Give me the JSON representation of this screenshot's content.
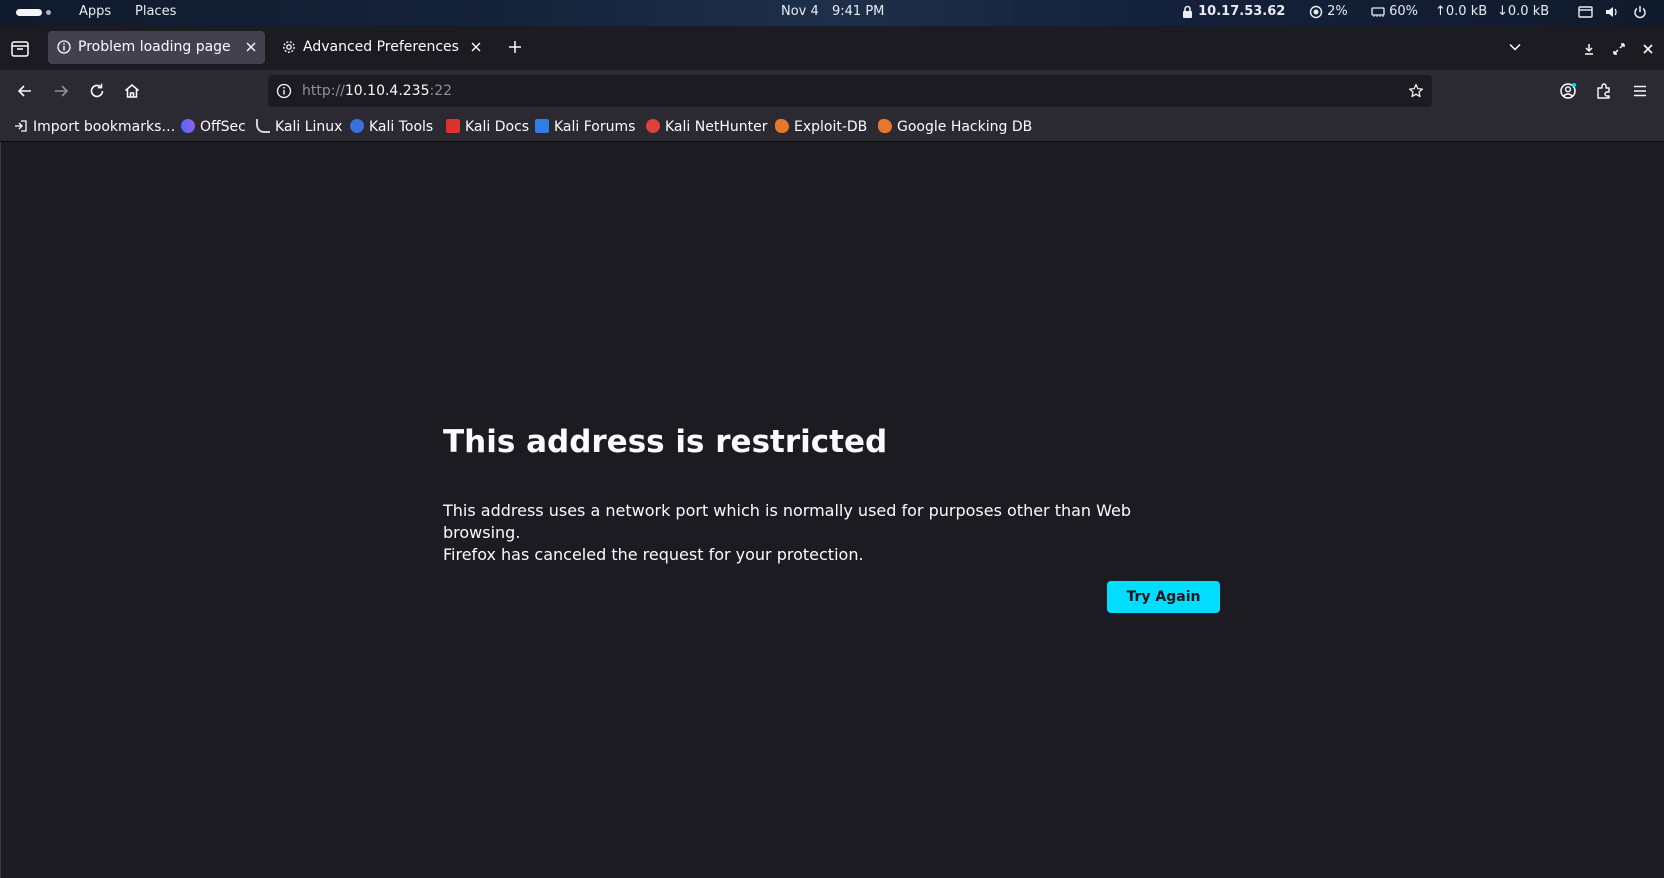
{
  "panel": {
    "menus": [
      "Apps",
      "Places"
    ],
    "date": "Nov 4",
    "time": "9:41 PM",
    "ip": "10.17.53.62",
    "cpu": "2%",
    "memory": "60%",
    "upload": "0.0 kB",
    "download": "0.0 kB"
  },
  "tabs": [
    {
      "label": "Problem loading page",
      "icon": "info-icon",
      "active": true
    },
    {
      "label": "Advanced Preferences",
      "icon": "gear-icon",
      "active": false
    }
  ],
  "urlbar": {
    "scheme": "http://",
    "host": "10.10.4.235",
    "port": ":22"
  },
  "bookmarks": [
    {
      "label": "Import bookmarks…",
      "icon": "import-icon",
      "color": "#fbfbfe"
    },
    {
      "label": "OffSec",
      "icon": "offsec-icon",
      "color": "#4a6cf7"
    },
    {
      "label": "Kali Linux",
      "icon": "kali-dragon-icon",
      "color": "#cfd3dc"
    },
    {
      "label": "Kali Tools",
      "icon": "kali-tools-icon",
      "color": "#3b6fe0"
    },
    {
      "label": "Kali Docs",
      "icon": "kali-docs-icon",
      "color": "#d9332f"
    },
    {
      "label": "Kali Forums",
      "icon": "kali-forums-icon",
      "color": "#2f7fe0"
    },
    {
      "label": "Kali NetHunter",
      "icon": "nethunter-icon",
      "color": "#e0403a"
    },
    {
      "label": "Exploit-DB",
      "icon": "exploit-db-icon",
      "color": "#e8772e"
    },
    {
      "label": "Google Hacking DB",
      "icon": "ghdb-icon",
      "color": "#e8772e"
    }
  ],
  "error": {
    "title": "This address is restricted",
    "line1": "This address uses a network port which is normally used for purposes other than Web browsing.",
    "line2": "Firefox has canceled the request for your protection.",
    "button": "Try Again"
  },
  "colors": {
    "accent": "#00ddff",
    "page_bg": "#1c1b22",
    "toolbar_bg": "#2b2a33",
    "active_tab": "#42414d"
  }
}
